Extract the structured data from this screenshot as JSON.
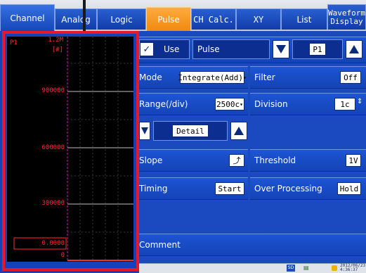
{
  "tabs": {
    "channel": "Channel",
    "analog": "Analog",
    "logic": "Logic",
    "pulse": "Pulse",
    "ch_calc": "CH Calc.",
    "xy": "XY",
    "list": "List",
    "waveform_line1": "Waveform",
    "waveform_line2": "Display"
  },
  "scope": {
    "channel": "P1",
    "top_value": "1.2M",
    "unit": "[#]",
    "values": [
      "900000",
      "600000",
      "300000",
      "0.0000",
      "0"
    ]
  },
  "pulse": {
    "use_label": "Use",
    "use_checked": "✓",
    "name": "Pulse",
    "channel_selected": "P1",
    "mode_label": "Mode",
    "mode_value": "Integrate(Add)",
    "filter_label": "Filter",
    "filter_value": "Off",
    "range_label": "Range(/div)",
    "range_value": "2500c",
    "division_label": "Division",
    "division_value": "1c",
    "detail_label": "Detail",
    "slope_label": "Slope",
    "slope_value": "⤴",
    "threshold_label": "Threshold",
    "threshold_value": "1V",
    "timing_label": "Timing",
    "timing_value": "Start",
    "over_label": "Over Processing",
    "over_value": "Hold",
    "comment_label": "Comment"
  },
  "status": {
    "sd": "SD",
    "datetime_date": "2012/06/23",
    "datetime_time": "4:36:37"
  }
}
